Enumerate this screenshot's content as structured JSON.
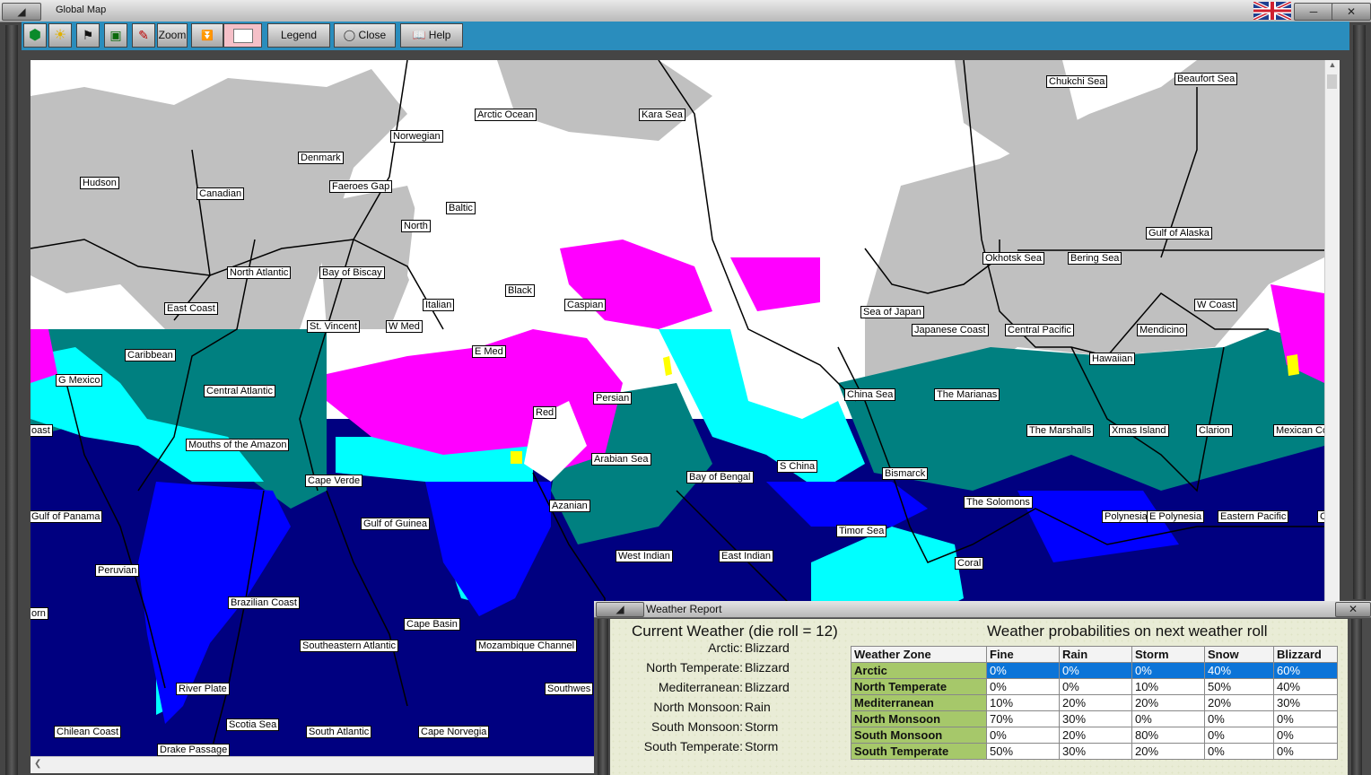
{
  "window": {
    "title": "Global Map"
  },
  "toolbar": {
    "zoom_label": "Zoom",
    "legend_label": "Legend",
    "close_label": "Close",
    "help_label": "Help"
  },
  "colors": {
    "snow": "#c0c0c0",
    "blizzard": "#ffffff",
    "mediterranean_storm": "#ff00ff",
    "fine_land": "#00ffff",
    "teal_sea": "#008080",
    "navy_sea": "#000080",
    "blue_sea": "#0000ff",
    "rain_yellow": "#ffff00",
    "toolbar_blue": "#2a8dbd",
    "selected_row": "#0b74d8",
    "zone_green": "#a6c86a"
  },
  "map": {
    "labels": {
      "chukchi_sea": "Chukchi Sea",
      "beaufort_sea": "Beaufort Sea",
      "arctic_ocean": "Arctic Ocean",
      "kara_sea": "Kara Sea",
      "norwegian": "Norwegian",
      "denmark": "Denmark",
      "hudson": "Hudson",
      "canadian": "Canadian",
      "faeroes_gap": "Faeroes Gap",
      "baltic": "Baltic",
      "north": "North",
      "north_atlantic": "North Atlantic",
      "bay_of_biscay": "Bay of Biscay",
      "black": "Black",
      "italian": "Italian",
      "caspian": "Caspian",
      "east_coast": "East Coast",
      "st_vincent": "St. Vincent",
      "w_med": "W Med",
      "e_med": "E Med",
      "caribbean": "Caribbean",
      "g_mexico": "G Mexico",
      "central_atlantic": "Central Atlantic",
      "persian": "Persian",
      "red": "Red",
      "coast_w": "oast",
      "mouths_amazon": "Mouths of the Amazon",
      "arabian_sea": "Arabian Sea",
      "cape_verde": "Cape Verde",
      "gulf_panama": "Gulf of Panama",
      "azanian": "Azanian",
      "gulf_guinea": "Gulf of Guinea",
      "peruvian": "Peruvian",
      "west_indian": "West Indian",
      "east_indian": "East Indian",
      "brazilian_coast": "Brazilian Coast",
      "horn": "orn",
      "cape_basin": "Cape Basin",
      "southeastern_atlantic": "Southeastern Atlantic",
      "mozambique": "Mozambique Channel",
      "river_plate": "River Plate",
      "southwest": "Southwes",
      "scotia_sea": "Scotia Sea",
      "chilean_coast": "Chilean Coast",
      "south_atlantic": "South Atlantic",
      "cape_norvegia": "Cape Norvegia",
      "drake_passage": "Drake Passage",
      "gulf_alaska": "Gulf of Alaska",
      "okhotsk_sea": "Okhotsk Sea",
      "bering_sea": "Bering Sea",
      "sea_japan": "Sea of Japan",
      "w_coast": "W Coast",
      "japanese_coast": "Japanese Coast",
      "central_pacific": "Central Pacific",
      "mendicino": "Mendicino",
      "hawaiian": "Hawaiian",
      "china_sea": "China Sea",
      "marianas": "The Marianas",
      "marshalls": "The Marshalls",
      "xmas_island": "Xmas Island",
      "clarion": "Clarion",
      "mexican_coast": "Mexican Co",
      "bay_bengal": "Bay of Bengal",
      "s_china": "S China",
      "bismarck": "Bismarck",
      "solomons": "The Solomons",
      "polynesia": "Polynesia",
      "e_polynesia": "E Polynesia",
      "eastern_pacific": "Eastern Pacific",
      "timor_sea": "Timor Sea",
      "coral": "Coral",
      "c_edge": "C"
    }
  },
  "weather_report": {
    "title": "Weather Report",
    "current_title": "Current Weather (die roll = 12)",
    "prob_title": "Weather probabilities on next weather roll",
    "current": [
      {
        "zone": "Arctic:",
        "weather": "Blizzard"
      },
      {
        "zone": "North Temperate:",
        "weather": "Blizzard"
      },
      {
        "zone": "Mediterranean:",
        "weather": "Blizzard"
      },
      {
        "zone": "North Monsoon:",
        "weather": "Rain"
      },
      {
        "zone": "South Monsoon:",
        "weather": "Storm"
      },
      {
        "zone": "South Temperate:",
        "weather": "Storm"
      }
    ],
    "headers": [
      "Weather Zone",
      "Fine",
      "Rain",
      "Storm",
      "Snow",
      "Blizzard"
    ],
    "rows": [
      {
        "zone": "Arctic",
        "values": [
          "0%",
          "0%",
          "0%",
          "40%",
          "60%"
        ]
      },
      {
        "zone": "North Temperate",
        "values": [
          "0%",
          "0%",
          "10%",
          "50%",
          "40%"
        ]
      },
      {
        "zone": "Mediterranean",
        "values": [
          "10%",
          "20%",
          "20%",
          "20%",
          "30%"
        ]
      },
      {
        "zone": "North Monsoon",
        "values": [
          "70%",
          "30%",
          "0%",
          "0%",
          "0%"
        ]
      },
      {
        "zone": "South Monsoon",
        "values": [
          "0%",
          "20%",
          "80%",
          "0%",
          "0%"
        ]
      },
      {
        "zone": "South Temperate",
        "values": [
          "50%",
          "30%",
          "20%",
          "0%",
          "0%"
        ]
      }
    ]
  }
}
